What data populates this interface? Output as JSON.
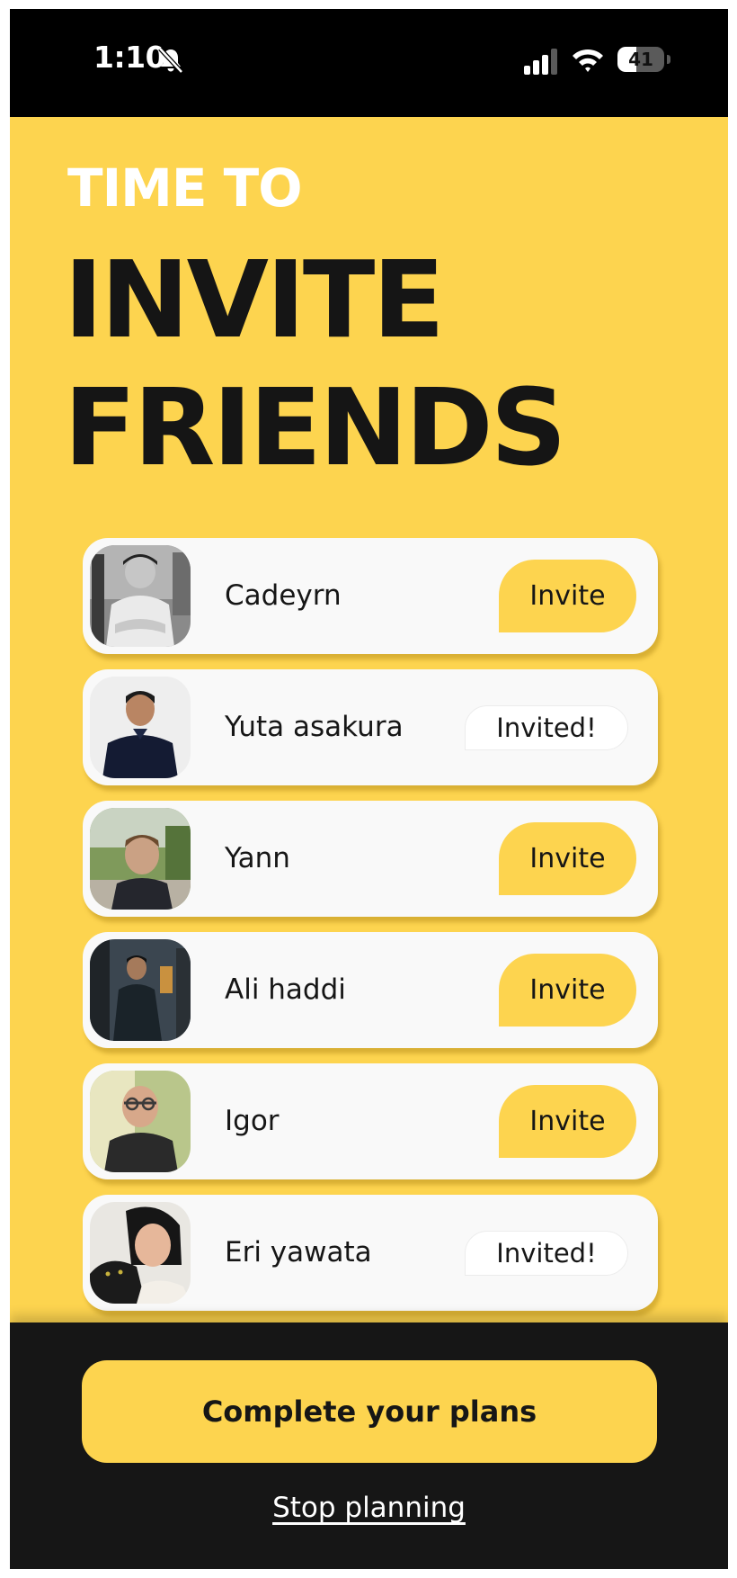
{
  "status_bar": {
    "time": "1:10",
    "battery": "41",
    "battery_level": 0.41,
    "icons": [
      "bell-slash-icon",
      "cellular-signal-icon",
      "wifi-icon",
      "battery-icon"
    ]
  },
  "header": {
    "eyebrow": "TIME TO",
    "headline_line1": "INVITE",
    "headline_line2": "FRIENDS"
  },
  "friends": [
    {
      "name": "Cadeyrn",
      "status": "invite",
      "action_label": "Invite"
    },
    {
      "name": "Yuta asakura",
      "status": "invited",
      "action_label": "Invited!"
    },
    {
      "name": "Yann",
      "status": "invite",
      "action_label": "Invite"
    },
    {
      "name": "Ali haddi",
      "status": "invite",
      "action_label": "Invite"
    },
    {
      "name": "Igor",
      "status": "invite",
      "action_label": "Invite"
    },
    {
      "name": "Eri yawata",
      "status": "invited",
      "action_label": "Invited!"
    }
  ],
  "footer": {
    "primary_label": "Complete your plans",
    "secondary_label": "Stop planning"
  },
  "colors": {
    "accent": "#FDD44F",
    "dark": "#161616",
    "card": "#F9F9F9"
  }
}
